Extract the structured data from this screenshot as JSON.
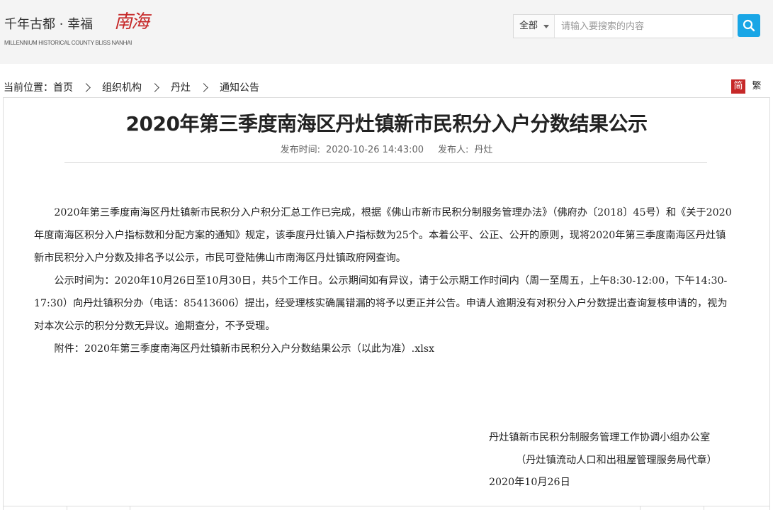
{
  "header": {
    "logo_text": "千年古都 · 幸福",
    "logo_script": "南海",
    "logo_sub": "MILLENNIUM HISTORICAL COUNTY BLISS NANHAI",
    "search_scope": "全部",
    "search_placeholder": "请输入要搜索的内容",
    "search_icon": "search-icon"
  },
  "breadcrumb": {
    "prefix": "当前位置：",
    "items": [
      "首页",
      "组织机构",
      "丹灶",
      "通知公告"
    ]
  },
  "lang": {
    "simplified": "简",
    "traditional": "繁"
  },
  "article": {
    "title": "2020年第三季度南海区丹灶镇新市民积分入户分数结果公示",
    "meta": {
      "time_label": "发布时间:",
      "time_value": "2020-10-26 14:43:00",
      "publisher_label": "发布人:",
      "publisher_value": "丹灶"
    },
    "paragraphs": [
      "2020年第三季度南海区丹灶镇新市民积分入户积分汇总工作已完成，根据《佛山市新市民积分制服务管理办法》（佛府办〔2018〕45号）和《关于2020年度南海区积分入户指标数和分配方案的通知》规定，该季度丹灶镇入户指标数为25个。本着公平、公正、公开的原则，现将2020年第三季度南海区丹灶镇新市民积分入户分数及排名予以公示，市民可登陆佛山市南海区丹灶镇政府网查询。",
      "公示时间为：2020年10月26日至10月30日，共5个工作日。公示期间如有异议，请于公示期工作时间内（周一至周五，上午8:30-12:00，下午14:30-17:30）向丹灶镇积分办（电话：85413606）提出，经受理核实确属错漏的将予以更正并公告。申请人逾期没有对积分入户分数提出查询复核申请的，视为对本次公示的积分分数无异议。逾期查分，不予受理。",
      "附件：2020年第三季度南海区丹灶镇新市民积分入户分数结果公示（以此为准）.xlsx"
    ],
    "signature": {
      "org": "丹灶镇新市民积分制服务管理工作协调小组办公室",
      "proxy": "（丹灶镇流动人口和出租屋管理服务局代章）",
      "date": "2020年10月26日"
    }
  },
  "colors": {
    "accent": "#19a6e6",
    "brand_red": "#c62828"
  }
}
